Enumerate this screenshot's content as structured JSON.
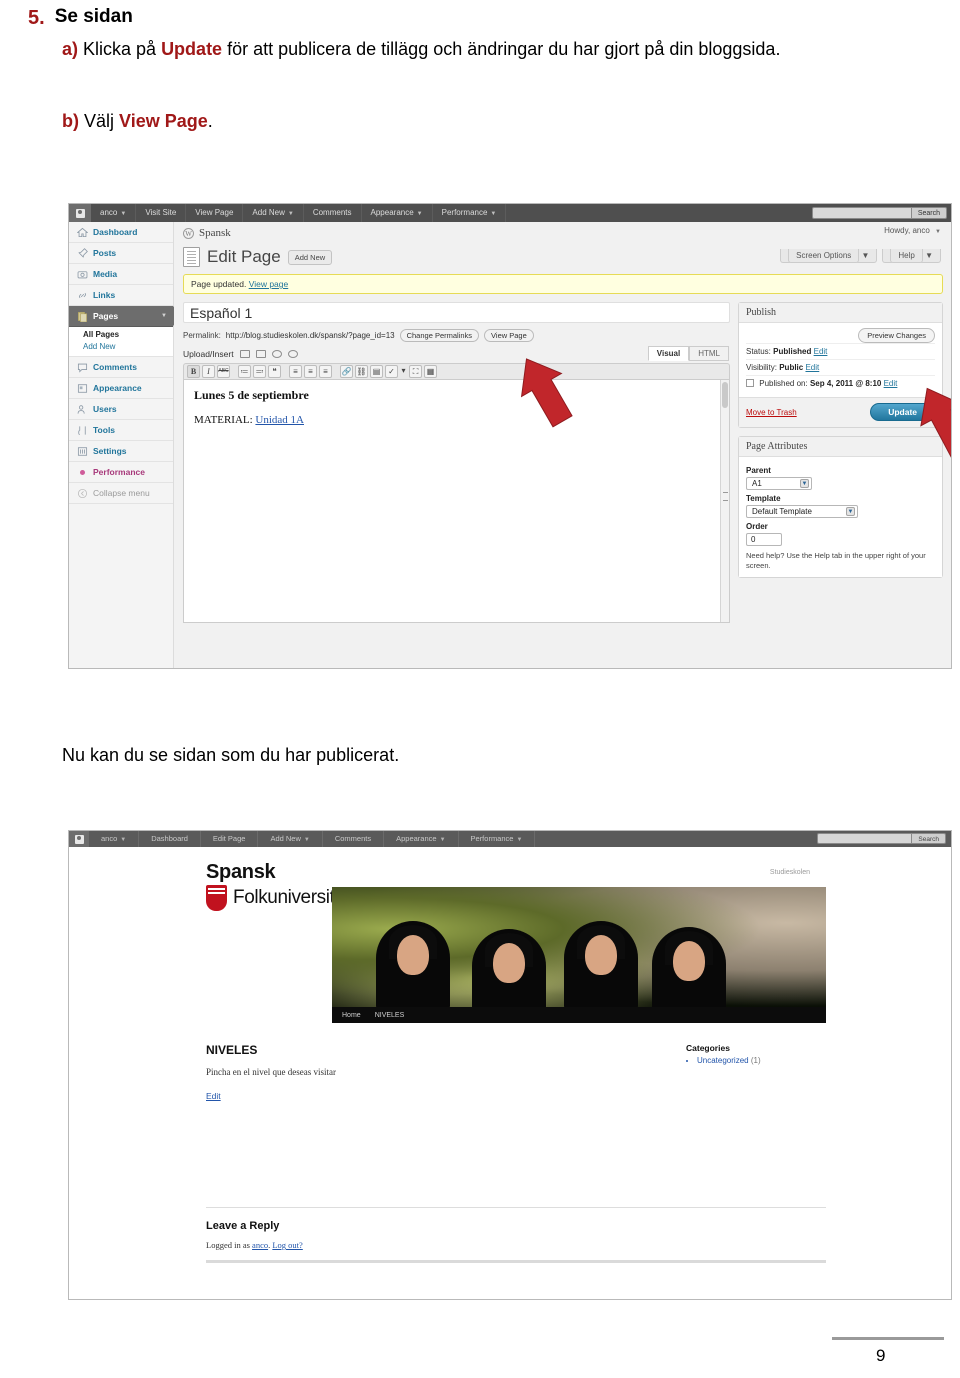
{
  "doc": {
    "step_number": "5.",
    "step_title": "Se sidan",
    "item_a_label": "a)",
    "item_a_text_1": " Klicka på ",
    "item_a_keyword": "Update",
    "item_a_text_2": " för att publicera de tillägg och ändringar du har gjort på din bloggsida.",
    "item_b_label": "b)",
    "item_b_text_1": " Välj ",
    "item_b_keyword": "View Page",
    "item_b_text_2": ".",
    "middle_text": "Nu kan du se sidan som du har publicerat.",
    "page_number": "9"
  },
  "shot1": {
    "adminbar": {
      "user": "anco",
      "items": [
        "Visit Site",
        "View Page",
        "Add New",
        "Comments",
        "Appearance",
        "Performance"
      ],
      "search_placeholder": "",
      "search_button": "Search"
    },
    "sidebar": {
      "items": [
        {
          "label": "Dashboard",
          "icon": "home-icon"
        },
        {
          "label": "Posts",
          "icon": "pin-icon"
        },
        {
          "label": "Media",
          "icon": "camera-icon"
        },
        {
          "label": "Links",
          "icon": "link-icon"
        },
        {
          "label": "Pages",
          "icon": "pages-icon"
        }
      ],
      "submenu": [
        "All Pages",
        "Add New"
      ],
      "items2": [
        {
          "label": "Comments",
          "icon": "comment-icon"
        },
        {
          "label": "Appearance",
          "icon": "appearance-icon"
        },
        {
          "label": "Users",
          "icon": "users-icon"
        },
        {
          "label": "Tools",
          "icon": "tools-icon"
        },
        {
          "label": "Settings",
          "icon": "settings-icon"
        }
      ],
      "performance": "Performance",
      "collapse": "Collapse menu"
    },
    "site_title": "Spansk",
    "howdy": "Howdy, anco",
    "page_heading": "Edit Page",
    "add_new_button": "Add New",
    "screen_options": "Screen Options",
    "help": "Help",
    "notice_text": "Page updated.",
    "notice_link": "View page",
    "title_value": "Español 1",
    "permalink_label": "Permalink:",
    "permalink_url": "http://blog.studieskolen.dk/spansk/?page_id=13",
    "change_permalinks_button": "Change Permalinks",
    "view_page_button": "View Page",
    "upload_insert_label": "Upload/Insert",
    "tab_visual": "Visual",
    "tab_html": "HTML",
    "editor_heading": "Lunes 5 de septiembre",
    "editor_text": "MATERIAL: ",
    "editor_link": "Unidad 1A",
    "publish": {
      "title": "Publish",
      "preview_button": "Preview Changes",
      "status_label": "Status:",
      "status_value": "Published",
      "status_edit": "Edit",
      "visibility_label": "Visibility:",
      "visibility_value": "Public",
      "visibility_edit": "Edit",
      "published_label": "Published on:",
      "published_value": "Sep 4, 2011 @ 8:10",
      "published_edit": "Edit",
      "trash_link": "Move to Trash",
      "update_button": "Update"
    },
    "attributes": {
      "title": "Page Attributes",
      "parent_label": "Parent",
      "parent_value": "A1",
      "template_label": "Template",
      "template_value": "Default Template",
      "order_label": "Order",
      "order_value": "0",
      "help_text": "Need help? Use the Help tab in the upper right of your screen."
    }
  },
  "shot2": {
    "adminbar": {
      "user": "anco",
      "items": [
        "Dashboard",
        "Edit Page",
        "Add New",
        "Comments",
        "Appearance",
        "Performance"
      ],
      "search_button": "Search"
    },
    "brand_line1": "Spansk",
    "brand_line2": "Folkuniversitetet",
    "corner_text": "Studieskolen",
    "nav": [
      "Home",
      "NIVELES"
    ],
    "content_heading": "NIVELES",
    "content_paragraph": "Pincha en el nivel que deseas visitar",
    "edit_link": "Edit",
    "sidebar_heading": "Categories",
    "sidebar_item": "Uncategorized",
    "sidebar_count": "(1)",
    "reply_heading": "Leave a Reply",
    "reply_logged_prefix": "Logged in as ",
    "reply_user": "anco",
    "reply_logout": "Log out?"
  },
  "colors": {
    "accent_red": "#a01818",
    "link_blue": "#21759b",
    "brand_red": "#c1121f",
    "arrow_red": "#c1262b"
  }
}
